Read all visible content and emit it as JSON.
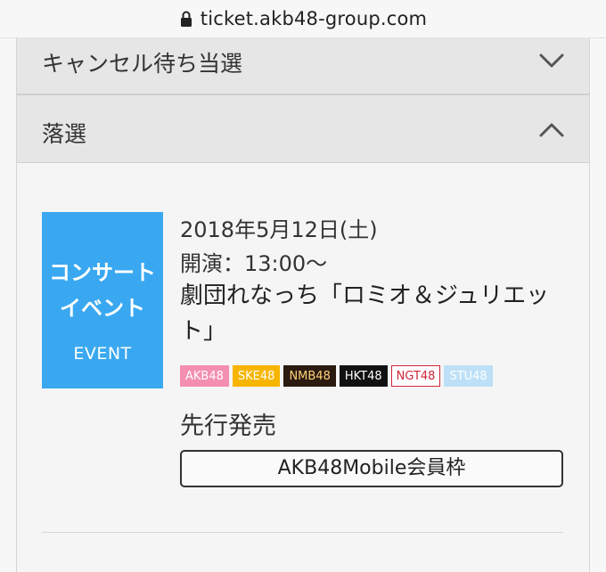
{
  "browser": {
    "url": "ticket.akb48-group.com",
    "lock_icon": "lock-icon"
  },
  "accordion": [
    {
      "label": "キャンセル待ち当選",
      "state": "collapsed",
      "icon": "chevron-down-icon"
    },
    {
      "label": "落選",
      "state": "expanded",
      "icon": "chevron-up-icon"
    }
  ],
  "event": {
    "badge": {
      "line1": "コンサート",
      "line2": "イベント",
      "line3": "EVENT",
      "color": "#3aa8f0"
    },
    "date": "2018年5月12日(土)",
    "time": "開演：13:00～",
    "title": "劇団れなっち「ロミオ＆ジュリエット」",
    "groups": [
      {
        "name": "AKB48",
        "bg": "#f48fb1",
        "fg": "#ffffff",
        "border": "#f48fb1"
      },
      {
        "name": "SKE48",
        "bg": "#f7b500",
        "fg": "#ffffff",
        "border": "#f7b500"
      },
      {
        "name": "NMB48",
        "bg": "#2b1a10",
        "fg": "#ffd27a",
        "border": "#2b1a10"
      },
      {
        "name": "HKT48",
        "bg": "#111111",
        "fg": "#ffffff",
        "border": "#111111"
      },
      {
        "name": "NGT48",
        "bg": "#ffffff",
        "fg": "#d0263a",
        "border": "#d0263a"
      },
      {
        "name": "STU48",
        "bg": "#bde0f7",
        "fg": "#ffffff",
        "border": "#bde0f7"
      }
    ],
    "sale_label": "先行発売",
    "member_button": "AKB48Mobile会員枠"
  }
}
